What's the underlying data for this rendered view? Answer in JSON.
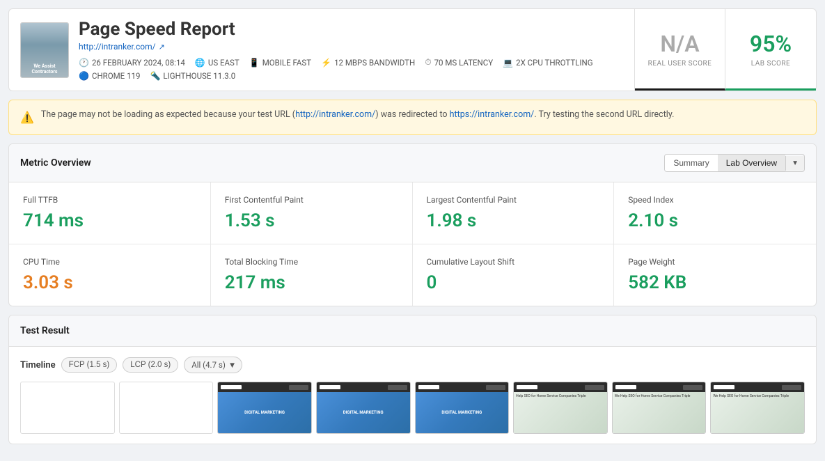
{
  "header": {
    "title": "Page Speed Report",
    "url": "http://intranker.com/",
    "date": "26 FEBRUARY 2024, 08:14",
    "location": "US EAST",
    "mobile": "MOBILE FAST",
    "bandwidth": "12 MBPS BANDWIDTH",
    "latency": "70 MS LATENCY",
    "cpu": "2X CPU THROTTLING",
    "browser": "CHROME 119",
    "lighthouse": "LIGHTHOUSE 11.3.0"
  },
  "scores": {
    "real_user_label": "REAL USER SCORE",
    "real_user_value": "N/A",
    "lab_label": "LAB SCORE",
    "lab_value": "95%"
  },
  "warning": {
    "text_before": "The page may not be loading as expected because your test URL (",
    "link1": "http://intranker.com/",
    "text_middle": ") was redirected to",
    "link2": "https://intranker.com/",
    "text_after": ". Try testing the second URL directly."
  },
  "metrics_section": {
    "title": "Metric Overview",
    "tab_summary": "Summary",
    "tab_lab": "Lab Overview",
    "metrics": [
      {
        "name": "Full TTFB",
        "value": "714 ms",
        "color": "green"
      },
      {
        "name": "First Contentful Paint",
        "value": "1.53 s",
        "color": "green"
      },
      {
        "name": "Largest Contentful Paint",
        "value": "1.98 s",
        "color": "green"
      },
      {
        "name": "Speed Index",
        "value": "2.10 s",
        "color": "green"
      },
      {
        "name": "CPU Time",
        "value": "3.03 s",
        "color": "orange"
      },
      {
        "name": "Total Blocking Time",
        "value": "217 ms",
        "color": "green"
      },
      {
        "name": "Cumulative Layout Shift",
        "value": "0",
        "color": "green"
      },
      {
        "name": "Page Weight",
        "value": "582 KB",
        "color": "green"
      }
    ]
  },
  "test_result": {
    "title": "Test Result",
    "timeline_label": "Timeline",
    "chip_fcp": "FCP (1.5 s)",
    "chip_lcp": "LCP (2.0 s)",
    "chip_all": "All (4.7 s)"
  },
  "frames": [
    {
      "type": "blank"
    },
    {
      "type": "blank"
    },
    {
      "type": "digital",
      "text": "DIGITAL\nMARKETING"
    },
    {
      "type": "digital",
      "text": "DIGITAL\nMARKETING"
    },
    {
      "type": "digital",
      "text": "DIGITAL\nMARKETING"
    },
    {
      "type": "seo",
      "text": "Help SEO for Home\nService Companies Triple"
    },
    {
      "type": "seo",
      "text": "We Help SEO for Home\nService Companies Triple"
    },
    {
      "type": "seo",
      "text": "We Help SEO for Home\nService Companies Triple"
    }
  ]
}
